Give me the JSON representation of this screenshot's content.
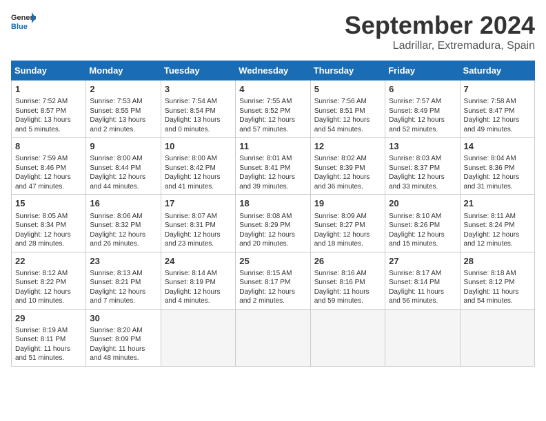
{
  "header": {
    "logo_general": "General",
    "logo_blue": "Blue",
    "month_title": "September 2024",
    "subtitle": "Ladrillar, Extremadura, Spain"
  },
  "calendar": {
    "days_of_week": [
      "Sunday",
      "Monday",
      "Tuesday",
      "Wednesday",
      "Thursday",
      "Friday",
      "Saturday"
    ],
    "weeks": [
      [
        null,
        {
          "day": "2",
          "sunrise": "Sunrise: 7:53 AM",
          "sunset": "Sunset: 8:55 PM",
          "daylight": "Daylight: 13 hours and 2 minutes."
        },
        {
          "day": "3",
          "sunrise": "Sunrise: 7:54 AM",
          "sunset": "Sunset: 8:54 PM",
          "daylight": "Daylight: 13 hours and 0 minutes."
        },
        {
          "day": "4",
          "sunrise": "Sunrise: 7:55 AM",
          "sunset": "Sunset: 8:52 PM",
          "daylight": "Daylight: 12 hours and 57 minutes."
        },
        {
          "day": "5",
          "sunrise": "Sunrise: 7:56 AM",
          "sunset": "Sunset: 8:51 PM",
          "daylight": "Daylight: 12 hours and 54 minutes."
        },
        {
          "day": "6",
          "sunrise": "Sunrise: 7:57 AM",
          "sunset": "Sunset: 8:49 PM",
          "daylight": "Daylight: 12 hours and 52 minutes."
        },
        {
          "day": "7",
          "sunrise": "Sunrise: 7:58 AM",
          "sunset": "Sunset: 8:47 PM",
          "daylight": "Daylight: 12 hours and 49 minutes."
        }
      ],
      [
        {
          "day": "1",
          "sunrise": "Sunrise: 7:52 AM",
          "sunset": "Sunset: 8:57 PM",
          "daylight": "Daylight: 13 hours and 5 minutes."
        },
        {
          "day": "9",
          "sunrise": "Sunrise: 8:00 AM",
          "sunset": "Sunset: 8:44 PM",
          "daylight": "Daylight: 12 hours and 44 minutes."
        },
        {
          "day": "10",
          "sunrise": "Sunrise: 8:00 AM",
          "sunset": "Sunset: 8:42 PM",
          "daylight": "Daylight: 12 hours and 41 minutes."
        },
        {
          "day": "11",
          "sunrise": "Sunrise: 8:01 AM",
          "sunset": "Sunset: 8:41 PM",
          "daylight": "Daylight: 12 hours and 39 minutes."
        },
        {
          "day": "12",
          "sunrise": "Sunrise: 8:02 AM",
          "sunset": "Sunset: 8:39 PM",
          "daylight": "Daylight: 12 hours and 36 minutes."
        },
        {
          "day": "13",
          "sunrise": "Sunrise: 8:03 AM",
          "sunset": "Sunset: 8:37 PM",
          "daylight": "Daylight: 12 hours and 33 minutes."
        },
        {
          "day": "14",
          "sunrise": "Sunrise: 8:04 AM",
          "sunset": "Sunset: 8:36 PM",
          "daylight": "Daylight: 12 hours and 31 minutes."
        }
      ],
      [
        {
          "day": "8",
          "sunrise": "Sunrise: 7:59 AM",
          "sunset": "Sunset: 8:46 PM",
          "daylight": "Daylight: 12 hours and 47 minutes."
        },
        {
          "day": "16",
          "sunrise": "Sunrise: 8:06 AM",
          "sunset": "Sunset: 8:32 PM",
          "daylight": "Daylight: 12 hours and 26 minutes."
        },
        {
          "day": "17",
          "sunrise": "Sunrise: 8:07 AM",
          "sunset": "Sunset: 8:31 PM",
          "daylight": "Daylight: 12 hours and 23 minutes."
        },
        {
          "day": "18",
          "sunrise": "Sunrise: 8:08 AM",
          "sunset": "Sunset: 8:29 PM",
          "daylight": "Daylight: 12 hours and 20 minutes."
        },
        {
          "day": "19",
          "sunrise": "Sunrise: 8:09 AM",
          "sunset": "Sunset: 8:27 PM",
          "daylight": "Daylight: 12 hours and 18 minutes."
        },
        {
          "day": "20",
          "sunrise": "Sunrise: 8:10 AM",
          "sunset": "Sunset: 8:26 PM",
          "daylight": "Daylight: 12 hours and 15 minutes."
        },
        {
          "day": "21",
          "sunrise": "Sunrise: 8:11 AM",
          "sunset": "Sunset: 8:24 PM",
          "daylight": "Daylight: 12 hours and 12 minutes."
        }
      ],
      [
        {
          "day": "15",
          "sunrise": "Sunrise: 8:05 AM",
          "sunset": "Sunset: 8:34 PM",
          "daylight": "Daylight: 12 hours and 28 minutes."
        },
        {
          "day": "23",
          "sunrise": "Sunrise: 8:13 AM",
          "sunset": "Sunset: 8:21 PM",
          "daylight": "Daylight: 12 hours and 7 minutes."
        },
        {
          "day": "24",
          "sunrise": "Sunrise: 8:14 AM",
          "sunset": "Sunset: 8:19 PM",
          "daylight": "Daylight: 12 hours and 4 minutes."
        },
        {
          "day": "25",
          "sunrise": "Sunrise: 8:15 AM",
          "sunset": "Sunset: 8:17 PM",
          "daylight": "Daylight: 12 hours and 2 minutes."
        },
        {
          "day": "26",
          "sunrise": "Sunrise: 8:16 AM",
          "sunset": "Sunset: 8:16 PM",
          "daylight": "Daylight: 11 hours and 59 minutes."
        },
        {
          "day": "27",
          "sunrise": "Sunrise: 8:17 AM",
          "sunset": "Sunset: 8:14 PM",
          "daylight": "Daylight: 11 hours and 56 minutes."
        },
        {
          "day": "28",
          "sunrise": "Sunrise: 8:18 AM",
          "sunset": "Sunset: 8:12 PM",
          "daylight": "Daylight: 11 hours and 54 minutes."
        }
      ],
      [
        {
          "day": "22",
          "sunrise": "Sunrise: 8:12 AM",
          "sunset": "Sunset: 8:22 PM",
          "daylight": "Daylight: 12 hours and 10 minutes."
        },
        {
          "day": "30",
          "sunrise": "Sunrise: 8:20 AM",
          "sunset": "Sunset: 8:09 PM",
          "daylight": "Daylight: 11 hours and 48 minutes."
        },
        null,
        null,
        null,
        null,
        null
      ],
      [
        {
          "day": "29",
          "sunrise": "Sunrise: 8:19 AM",
          "sunset": "Sunset: 8:11 PM",
          "daylight": "Daylight: 11 hours and 51 minutes."
        },
        null,
        null,
        null,
        null,
        null,
        null
      ]
    ]
  }
}
